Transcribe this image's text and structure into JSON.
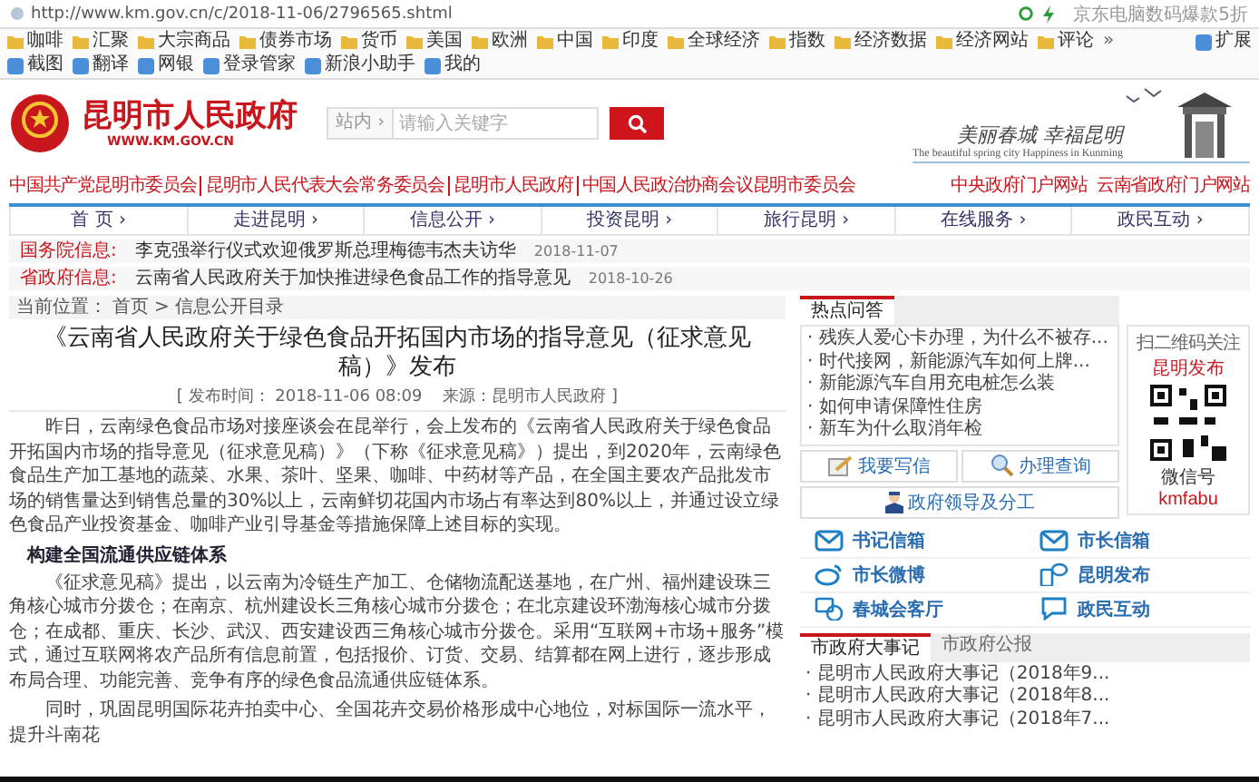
{
  "browser": {
    "url": "http://www.km.gov.cn/c/2018-11-06/2796565.shtml",
    "ad": "京东电脑数码爆款5折",
    "bookmarks": [
      "咖啡",
      "汇聚",
      "大宗商品",
      "债券市场",
      "货币",
      "美国",
      "欧洲",
      "中国",
      "印度",
      "全球经济",
      "指数",
      "经济数据",
      "经济网站",
      "评论"
    ],
    "more": "»",
    "tools": [
      "扩展",
      "截图",
      "翻译",
      "网银",
      "登录管家",
      "新浪小助手",
      "我的"
    ]
  },
  "header": {
    "title": "昆明市人民政府",
    "domain": "WWW.KM.GOV.CN",
    "search": {
      "scope": "站内 ›",
      "placeholder": "请输入关键字"
    },
    "slogan": "美丽春城 幸福昆明",
    "slogan_en": "The beautiful spring city  Happiness in Kunming"
  },
  "links": [
    "中国共产党昆明市委员会",
    "昆明市人民代表大会常务委员会",
    "昆明市人民政府",
    "中国人民政治协商会议昆明市委员会"
  ],
  "portal_links": [
    "中央政府门户网站",
    "云南省政府门户网站"
  ],
  "nav": [
    {
      "label": "首 页",
      "arrow": "›"
    },
    {
      "label": "走进昆明",
      "arrow": "›"
    },
    {
      "label": "信息公开",
      "arrow": "›"
    },
    {
      "label": "投资昆明",
      "arrow": "›"
    },
    {
      "label": "旅行昆明",
      "arrow": "›"
    },
    {
      "label": "在线服务",
      "arrow": "›"
    },
    {
      "label": "政民互动",
      "arrow": "›"
    }
  ],
  "notices": [
    {
      "label": "国务院信息:",
      "text": "李克强举行仪式欢迎俄罗斯总理梅德韦杰夫访华",
      "date": "2018-11-07"
    },
    {
      "label": "省政府信息:",
      "text": "云南省人民政府关于加快推进绿色食品工作的指导意见",
      "date": "2018-10-26"
    }
  ],
  "breadcrumb": {
    "label": "当前位置：",
    "items": [
      "首页",
      "信息公开目录"
    ],
    "sep": ">"
  },
  "article": {
    "title": "《云南省人民政府关于绿色食品开拓国内市场的指导意见（征求意见稿）》发布",
    "meta": "[ 发布时间： 2018-11-06 08:09    来源：昆明市人民政府 ]",
    "blocks": [
      {
        "kind": "para",
        "text": "昨日，云南绿色食品市场对接座谈会在昆举行，会上发布的《云南省人民政府关于绿色食品开拓国内市场的指导意见（征求意见稿）》（下称《征求意见稿》）提出，到2020年，云南绿色食品生产加工基地的蔬菜、水果、茶叶、坚果、咖啡、中药材等产品，在全国主要农产品批发市场的销售量达到销售总量的30%以上，云南鲜切花国内市场占有率达到80%以上，并通过设立绿色食品产业投资基金、咖啡产业引导基金等措施保障上述目标的实现。"
      },
      {
        "kind": "heading",
        "text": "构建全国流通供应链体系"
      },
      {
        "kind": "para",
        "text": "《征求意见稿》提出，以云南为冷链生产加工、仓储物流配送基地，在广州、福州建设珠三角核心城市分拨仓；在南京、杭州建设长三角核心城市分拨仓；在北京建设环渤海核心城市分拨仓；在成都、重庆、长沙、武汉、西安建设西三角核心城市分拨仓。采用“互联网+市场+服务”模式，通过互联网将农产品所有信息前置，包括报价、订货、交易、结算都在网上进行，逐步形成布局合理、功能完善、竞争有序的绿色食品流通供应链体系。"
      },
      {
        "kind": "para",
        "text": "同时，巩固昆明国际花卉拍卖中心、全国花卉交易价格形成中心地位，对标国际一流水平，提升斗南花"
      }
    ]
  },
  "sidebar": {
    "tabs": [
      {
        "label": "热点问答",
        "selected": true
      }
    ],
    "hot": [
      "· 残疾人爱心卡办理，为什么不被存...",
      "· 时代接网，新能源汽车如何上牌...",
      "· 新能源汽车自用充电桩怎么装",
      "· 如何申请保障性住房",
      "· 新车为什么取消年检"
    ],
    "buttons": [
      {
        "label": "我要写信",
        "kind": "pen"
      },
      {
        "label": "办理查询",
        "kind": "magnifier"
      },
      {
        "label": "政府领导及分工",
        "kind": "person"
      }
    ],
    "qr": {
      "caption": "扫二维码关注",
      "account": "昆明发布",
      "id_label": "微信号",
      "id": "kmfabu"
    },
    "services": [
      {
        "label": "书记信箱",
        "kind": "mail"
      },
      {
        "label": "市长信箱",
        "kind": "mail"
      },
      {
        "label": "市长微博",
        "kind": "weibo"
      },
      {
        "label": "昆明发布",
        "kind": "phone"
      },
      {
        "label": "春城会客厅",
        "kind": "chat"
      },
      {
        "label": "政民互动",
        "kind": "bubble"
      }
    ],
    "news_tabs": [
      {
        "label": "市政府大事记",
        "selected": true
      },
      {
        "label": "市政府公报",
        "selected": false
      }
    ],
    "news": [
      "· 昆明市人民政府大事记（2018年9...",
      "· 昆明市人民政府大事记（2018年8...",
      "· 昆明市人民政府大事记（2018年7..."
    ]
  }
}
